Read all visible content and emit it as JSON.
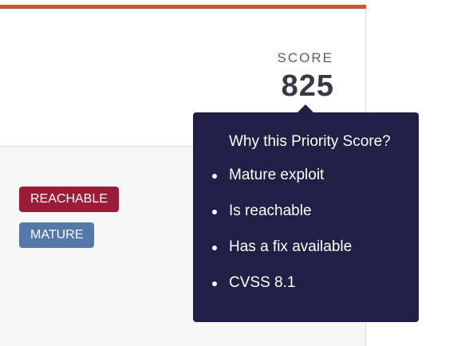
{
  "colors": {
    "accent_bar": "#c35a2e",
    "tooltip_bg": "#211f45",
    "badge_reachable": "#9b1c36",
    "badge_mature": "#5678a8"
  },
  "score": {
    "label": "SCORE",
    "value": "825"
  },
  "badges": [
    {
      "label": "REACHABLE"
    },
    {
      "label": "MATURE"
    }
  ],
  "tooltip": {
    "title": "Why this Priority Score?",
    "items": [
      {
        "label": "Mature exploit"
      },
      {
        "label": "Is reachable"
      },
      {
        "label": "Has a fix available"
      },
      {
        "label": "CVSS 8.1"
      }
    ]
  }
}
